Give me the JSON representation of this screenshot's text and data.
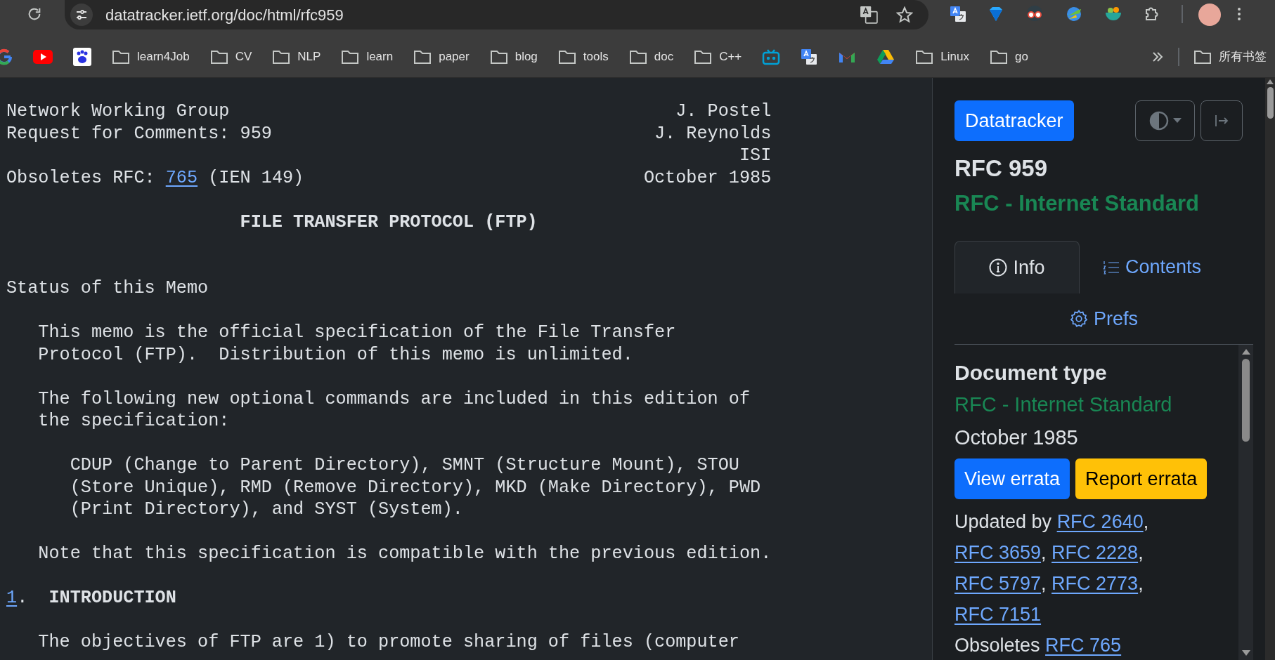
{
  "browser": {
    "url": "datatracker.ietf.org/doc/html/rfc959"
  },
  "bookmarks": [
    {
      "kind": "site"
    },
    {
      "kind": "site"
    },
    {
      "kind": "site"
    },
    {
      "kind": "folder",
      "label": "learn4Job"
    },
    {
      "kind": "folder",
      "label": "CV"
    },
    {
      "kind": "folder",
      "label": "NLP"
    },
    {
      "kind": "folder",
      "label": "learn"
    },
    {
      "kind": "folder",
      "label": "paper"
    },
    {
      "kind": "folder",
      "label": "blog"
    },
    {
      "kind": "folder",
      "label": "tools"
    },
    {
      "kind": "folder",
      "label": "doc"
    },
    {
      "kind": "folder",
      "label": "C++"
    },
    {
      "kind": "site"
    },
    {
      "kind": "site"
    },
    {
      "kind": "site"
    },
    {
      "kind": "site"
    },
    {
      "kind": "folder",
      "label": "Linux"
    },
    {
      "kind": "folder",
      "label": "go"
    }
  ],
  "all_bookmarks": "所有书签",
  "document": {
    "header": [
      {
        "left": "Network Working Group",
        "right": "J. Postel"
      },
      {
        "left": "Request for Comments: 959",
        "right": "J. Reynolds"
      },
      {
        "right": "ISI"
      }
    ],
    "obsoletes": {
      "label": "Obsoletes RFC:",
      "link": "765",
      "note": "(IEN 149)",
      "date": "October 1985"
    },
    "title": "FILE TRANSFER PROTOCOL (FTP)",
    "blocks": [
      {
        "kind": "heading",
        "text": "Status of this Memo"
      },
      {
        "kind": "paragraph",
        "lines": [
          "This memo is the official specification of the File Transfer",
          "Protocol (FTP).  Distribution of this memo is unlimited."
        ]
      },
      {
        "kind": "paragraph",
        "lines": [
          "The following new optional commands are included in this edition of",
          "the specification:"
        ]
      },
      {
        "kind": "nested",
        "lines": [
          "CDUP (Change to Parent Directory), SMNT (Structure Mount), STOU",
          "(Store Unique), RMD (Remove Directory), MKD (Make Directory), PWD",
          "(Print Directory), and SYST (System)."
        ]
      },
      {
        "kind": "paragraph",
        "lines": [
          "Note that this specification is compatible with the previous edition."
        ]
      },
      {
        "kind": "section",
        "number": "1",
        "suffix": ".",
        "title": "INTRODUCTION"
      },
      {
        "kind": "paragraph",
        "lines": [
          "The objectives of FTP are 1) to promote sharing of files (computer"
        ]
      }
    ]
  },
  "panel": {
    "brand_button": "Datatracker",
    "title": "RFC 959",
    "status": "RFC - Internet Standard",
    "tabs": [
      {
        "label": "Info",
        "selected": true
      },
      {
        "label": "Contents",
        "selected": false
      },
      {
        "label": "Prefs",
        "selected": false
      }
    ],
    "info": {
      "heading": "Document type",
      "type": "RFC - Internet Standard",
      "date": "October 1985",
      "buttons": [
        {
          "label": "View errata",
          "kind": "primary"
        },
        {
          "label": "Report errata",
          "kind": "warning"
        }
      ],
      "updated_by": {
        "label": "Updated by",
        "separator": ",",
        "links": [
          "RFC 2640",
          "RFC 3659",
          "RFC 2228",
          "RFC 5797",
          "RFC 2773",
          "RFC 7151"
        ]
      },
      "obsoletes": {
        "label": "Obsoletes",
        "links": [
          "RFC 765"
        ]
      }
    }
  }
}
